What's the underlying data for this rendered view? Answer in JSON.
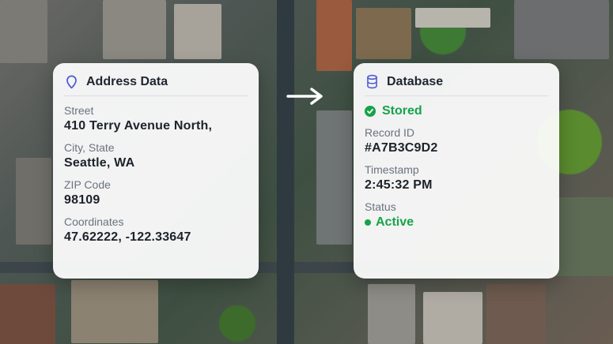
{
  "address_card": {
    "title": "Address Data",
    "icon": "map-pin-icon",
    "fields": [
      {
        "label": "Street",
        "value": "410 Terry Avenue North,"
      },
      {
        "label": "City, State",
        "value": "Seattle, WA"
      },
      {
        "label": "ZIP Code",
        "value": "98109"
      },
      {
        "label": "Coordinates",
        "value": "47.62222, -122.33647"
      }
    ]
  },
  "database_card": {
    "title": "Database",
    "icon": "database-icon",
    "stored_label": "Stored",
    "fields": [
      {
        "label": "Record ID",
        "value": "#A7B3C9D2"
      },
      {
        "label": "Timestamp",
        "value": "2:45:32 PM"
      }
    ],
    "status_label": "Status",
    "status_value": "Active"
  },
  "colors": {
    "accent": "#4f5bd5",
    "success": "#16a34a"
  }
}
